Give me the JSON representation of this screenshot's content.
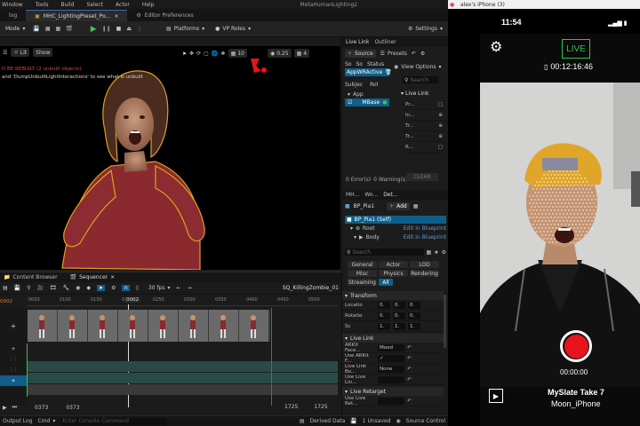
{
  "ue": {
    "menu": [
      "Window",
      "Tools",
      "Build",
      "Select",
      "Actor",
      "Help"
    ],
    "project_title": "MetaHumanLighting2",
    "tabs": [
      {
        "label": "log",
        "active": false
      },
      {
        "label": "MHC_LightingPreset_Po...",
        "active": true
      },
      {
        "label": "Editor Preferences",
        "active": false
      }
    ],
    "toolbar": {
      "mode": "Mode",
      "platforms": "Platforms",
      "vp_roles": "VP Roles",
      "settings": "Settings"
    },
    "viewport": {
      "lit": "Lit",
      "show": "Show",
      "msg_red": "D BE REBUILT (2 unbuilt objects)",
      "msg_white": "and 'DumpUnbuiltLightInteractions' to see what is unbuilt",
      "snap_value": "10",
      "speed": "0.25",
      "grid_count": "4"
    },
    "live_link": {
      "tab": "Live Link",
      "outliner": "Outliner",
      "source_btn": "Source",
      "presets_btn": "Presets",
      "cols": [
        "So",
        "So",
        "Status"
      ],
      "source_name": "AppWRActive",
      "subject_cols": [
        "Subjec",
        "Rol"
      ],
      "subject_app": "App",
      "subject_name": "MBase",
      "view_options": "View Options",
      "search_ph": "Search",
      "section": "Live Link",
      "detail_rows": [
        "Pr...",
        "In...",
        "Tr...",
        "Tr...",
        "R..."
      ],
      "errors": "0 Error(s)",
      "warnings": "0 Warning(s)",
      "clear": "CLEAR"
    },
    "details": {
      "tabs": [
        "MH...",
        "Wo...",
        "Det..."
      ],
      "actor": "BP_Pia1",
      "add": "Add",
      "self": "BP_Pia1 (Self)",
      "root": "Root",
      "root_link": "Edit in Blueprint",
      "body": "Body",
      "body_link": "Edit in Blueprint",
      "search_ph": "Search",
      "filters1": [
        "General",
        "Actor",
        "LOD"
      ],
      "filters2": [
        "Misc",
        "Physics",
        "Rendering"
      ],
      "filters3": [
        "Streaming",
        "All"
      ],
      "sections": {
        "transform": "Transform",
        "livelink": "Live Link",
        "retarget": "Live Retarget"
      },
      "transform_rows": [
        {
          "label": "Locatio",
          "vals": [
            "0.",
            "0.",
            "0."
          ]
        },
        {
          "label": "Rotatio",
          "vals": [
            "0.",
            "0.",
            "0."
          ]
        },
        {
          "label": "Sc",
          "vals": [
            "1.",
            "1.",
            "1."
          ]
        }
      ],
      "livelink_rows": [
        {
          "label": "ARKit Face...",
          "value": "Mood"
        },
        {
          "label": "Use ARKit F...",
          "value": "✓"
        },
        {
          "label": "Live Link Bo...",
          "value": "None"
        },
        {
          "label": "Use Live Lin...",
          "value": ""
        }
      ],
      "retarget_rows": [
        {
          "label": "Use Live Ret...",
          "value": ""
        }
      ]
    },
    "sequencer": {
      "tabs": [
        "Content Browser",
        "Sequencer"
      ],
      "fps": "30 fps",
      "sequence": "SQ_KillingZombie_01",
      "frame_start": "0002",
      "current": "0002",
      "ticks": [
        "0050",
        "0100",
        "0150",
        "0200",
        "0250",
        "0300",
        "0350",
        "0400",
        "0450",
        "0500"
      ],
      "bottom_left": "0373",
      "bottom_mid": "0373",
      "bottom_r1": "1725",
      "bottom_r2": "1725"
    },
    "statusbar": {
      "output": "Output Log",
      "cmd": "Cmd",
      "cmd_ph": "Enter Console Command",
      "derived": "Derived Data",
      "unsaved": "1 Unsaved",
      "source": "Source Control"
    }
  },
  "phone": {
    "window_title": "alex's iPhone (3)",
    "time": "11:54",
    "live_label": "LIVE",
    "timecode": "00:12:16:46",
    "rec_time": "00:00:00",
    "slate": "MySlate Take 7",
    "device": "Moon_iPhone",
    "colors": {
      "live": "#33c24a",
      "record": "#e8141d"
    }
  }
}
